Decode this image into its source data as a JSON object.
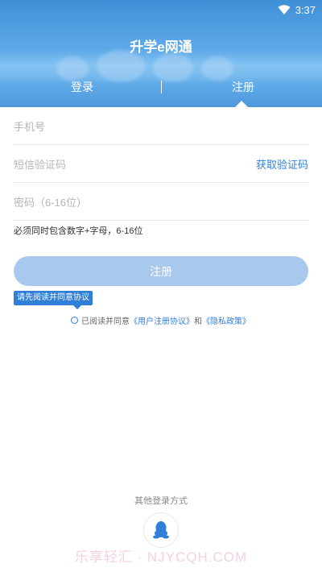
{
  "status_bar": {
    "time": "3:37"
  },
  "header": {
    "title": "升学e网通",
    "tabs": [
      {
        "label": "登录",
        "active": false
      },
      {
        "label": "注册",
        "active": true
      }
    ]
  },
  "form": {
    "phone_placeholder": "手机号",
    "code_placeholder": "短信验证码",
    "get_code_label": "获取验证码",
    "password_placeholder": "密码（6-16位）",
    "password_hint": "必须同时包含数字+字母，6-16位",
    "submit_label": "注册"
  },
  "agreement": {
    "tooltip": "请先阅读并同意协议",
    "prefix": "已阅读并同意",
    "user_agreement": "《用户注册协议》",
    "and": "和",
    "privacy_policy": "《隐私政策》",
    "checked": false
  },
  "other_login": {
    "label": "其他登录方式",
    "options": [
      {
        "icon": "qq-icon"
      }
    ]
  },
  "watermark": "乐享轻汇 · NJYCQH.COM",
  "colors": {
    "accent": "#2f7fd8",
    "button_disabled": "#a8c8ee",
    "header": "#4d97dc"
  }
}
